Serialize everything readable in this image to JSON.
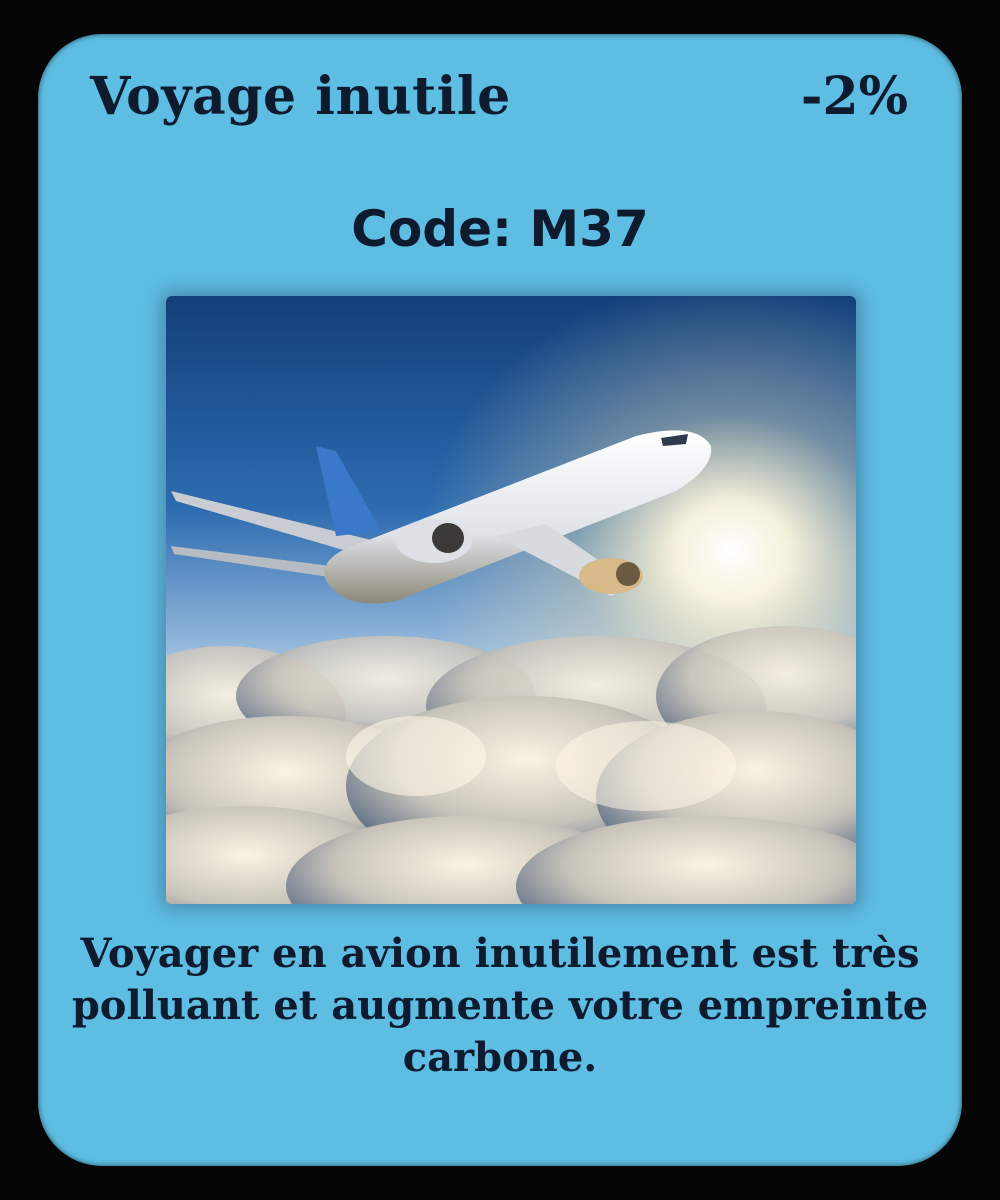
{
  "card": {
    "title": "Voyage inutile",
    "penalty": "-2%",
    "code": "Code: M37",
    "description": "Voyager en avion inutilement est très polluant et augmente votre empreinte carbone.",
    "illustration": "airplane-above-clouds"
  },
  "colors": {
    "card_background": "#5ebde2",
    "text": "#0e1a2e",
    "page_background": "#050505"
  }
}
